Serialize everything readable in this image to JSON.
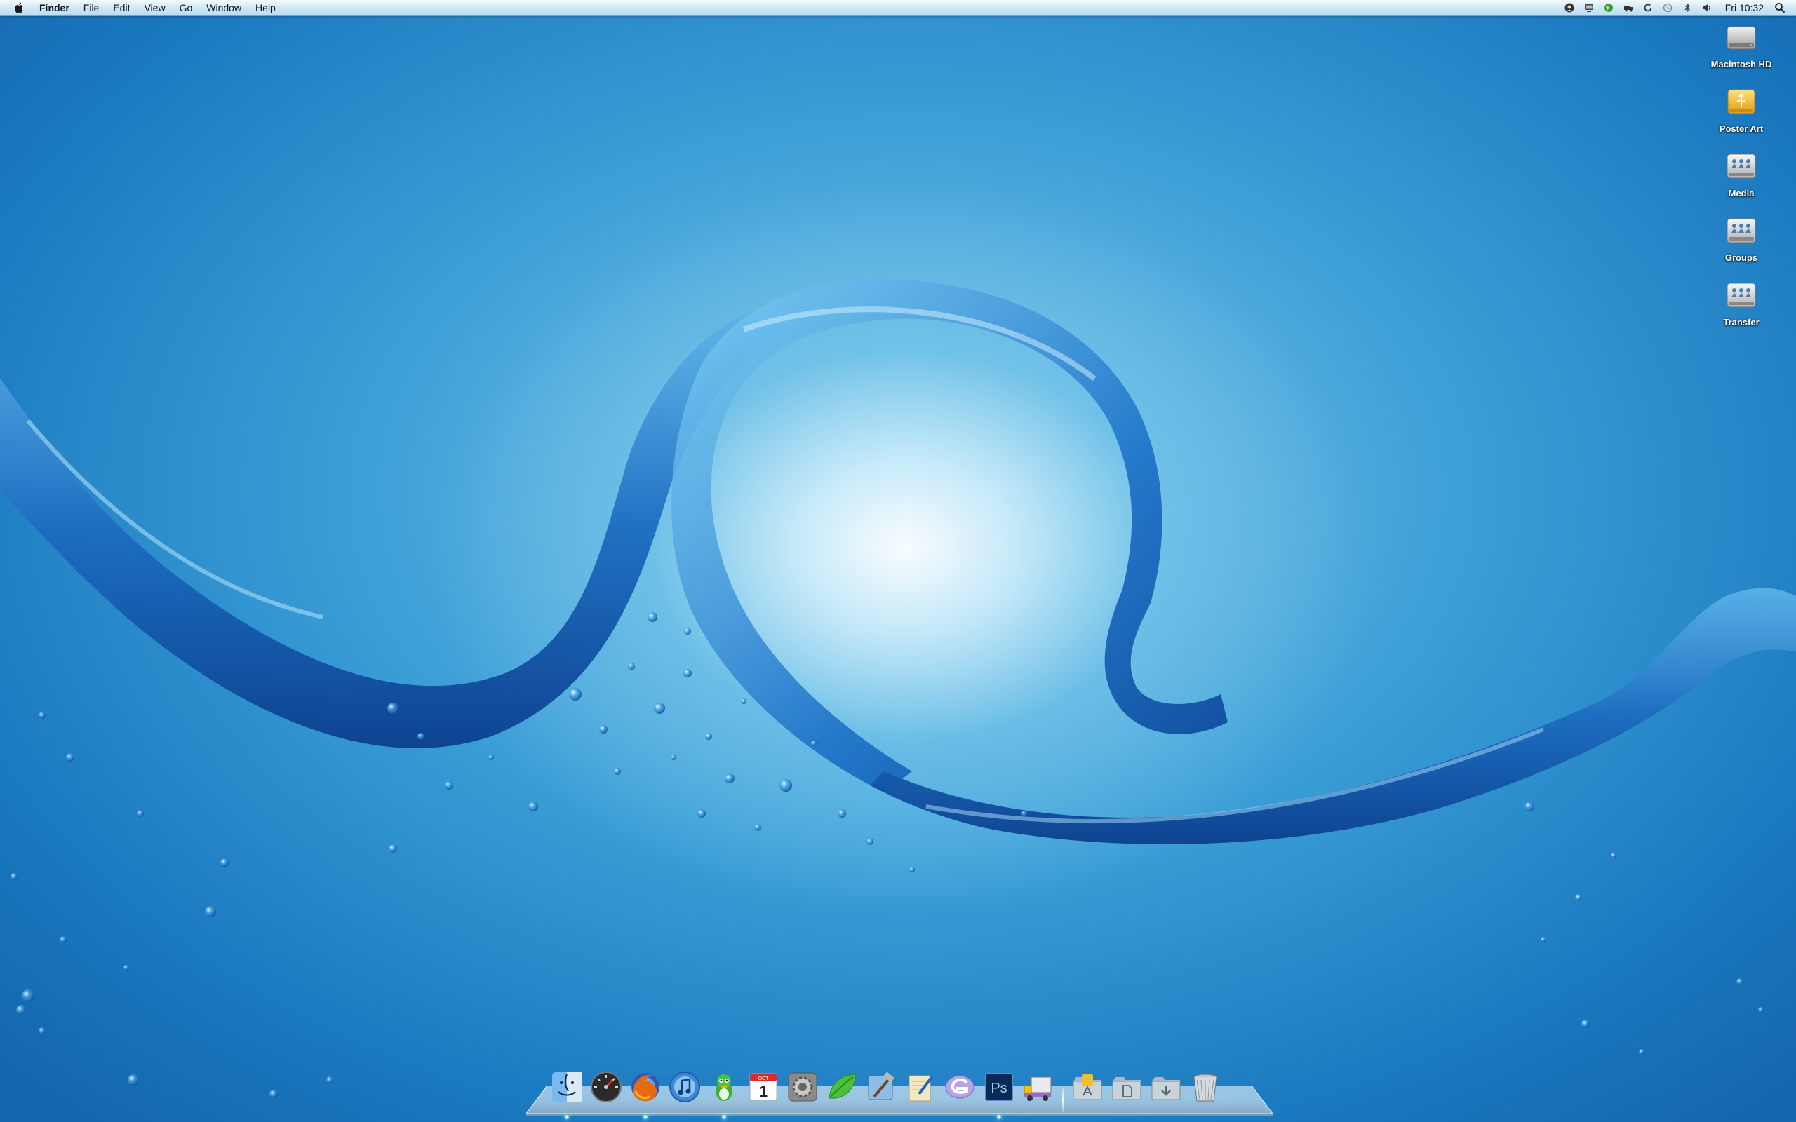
{
  "menubar": {
    "apple_icon": "apple-logo-icon",
    "app_name": "Finder",
    "menus": [
      "File",
      "Edit",
      "View",
      "Go",
      "Window",
      "Help"
    ],
    "status_icons": [
      "skype-icon",
      "display-icon",
      "globe-icon",
      "sync-icon",
      "refresh-icon",
      "time-machine-icon",
      "bluetooth-icon",
      "volume-icon"
    ],
    "clock": "Fri 10:32",
    "spotlight_icon": "search-icon"
  },
  "desktop": {
    "icons": [
      {
        "label": "Macintosh HD",
        "icon": "hard-drive-icon"
      },
      {
        "label": "Poster Art",
        "icon": "usb-drive-icon"
      },
      {
        "label": "Media",
        "icon": "network-share-icon"
      },
      {
        "label": "Groups",
        "icon": "network-share-icon"
      },
      {
        "label": "Transfer",
        "icon": "network-share-icon"
      }
    ]
  },
  "dock": {
    "apps": [
      {
        "name": "Finder",
        "icon": "finder-icon",
        "running": true
      },
      {
        "name": "Dashboard",
        "icon": "dashboard-icon",
        "running": false
      },
      {
        "name": "Firefox",
        "icon": "firefox-icon",
        "running": true
      },
      {
        "name": "iTunes",
        "icon": "itunes-icon",
        "running": false
      },
      {
        "name": "Adium",
        "icon": "adium-icon",
        "running": true
      },
      {
        "name": "iCal",
        "icon": "calendar-icon",
        "running": false,
        "date": "1",
        "month": "OCT"
      },
      {
        "name": "System Preferences",
        "icon": "system-preferences-icon",
        "running": false
      },
      {
        "name": "Coda",
        "icon": "leaf-icon",
        "running": false
      },
      {
        "name": "Xcode",
        "icon": "xcode-hammer-icon",
        "running": false
      },
      {
        "name": "Pages",
        "icon": "pen-document-icon",
        "running": false
      },
      {
        "name": "Espresso",
        "icon": "espresso-icon",
        "running": false
      },
      {
        "name": "Photoshop",
        "icon": "photoshop-icon",
        "running": true,
        "text": "Ps"
      },
      {
        "name": "Transmit",
        "icon": "transmit-truck-icon",
        "running": false
      }
    ],
    "stacks": [
      {
        "name": "Applications",
        "icon": "applications-folder-icon"
      },
      {
        "name": "Documents",
        "icon": "documents-folder-icon"
      },
      {
        "name": "Downloads",
        "icon": "downloads-folder-icon"
      },
      {
        "name": "Trash",
        "icon": "trash-icon"
      }
    ]
  },
  "colors": {
    "wallpaper_deep": "#1466ac",
    "wallpaper_light": "#dff4fc",
    "wave": "#1a5fb4",
    "menubar": "#cfe8f5"
  }
}
